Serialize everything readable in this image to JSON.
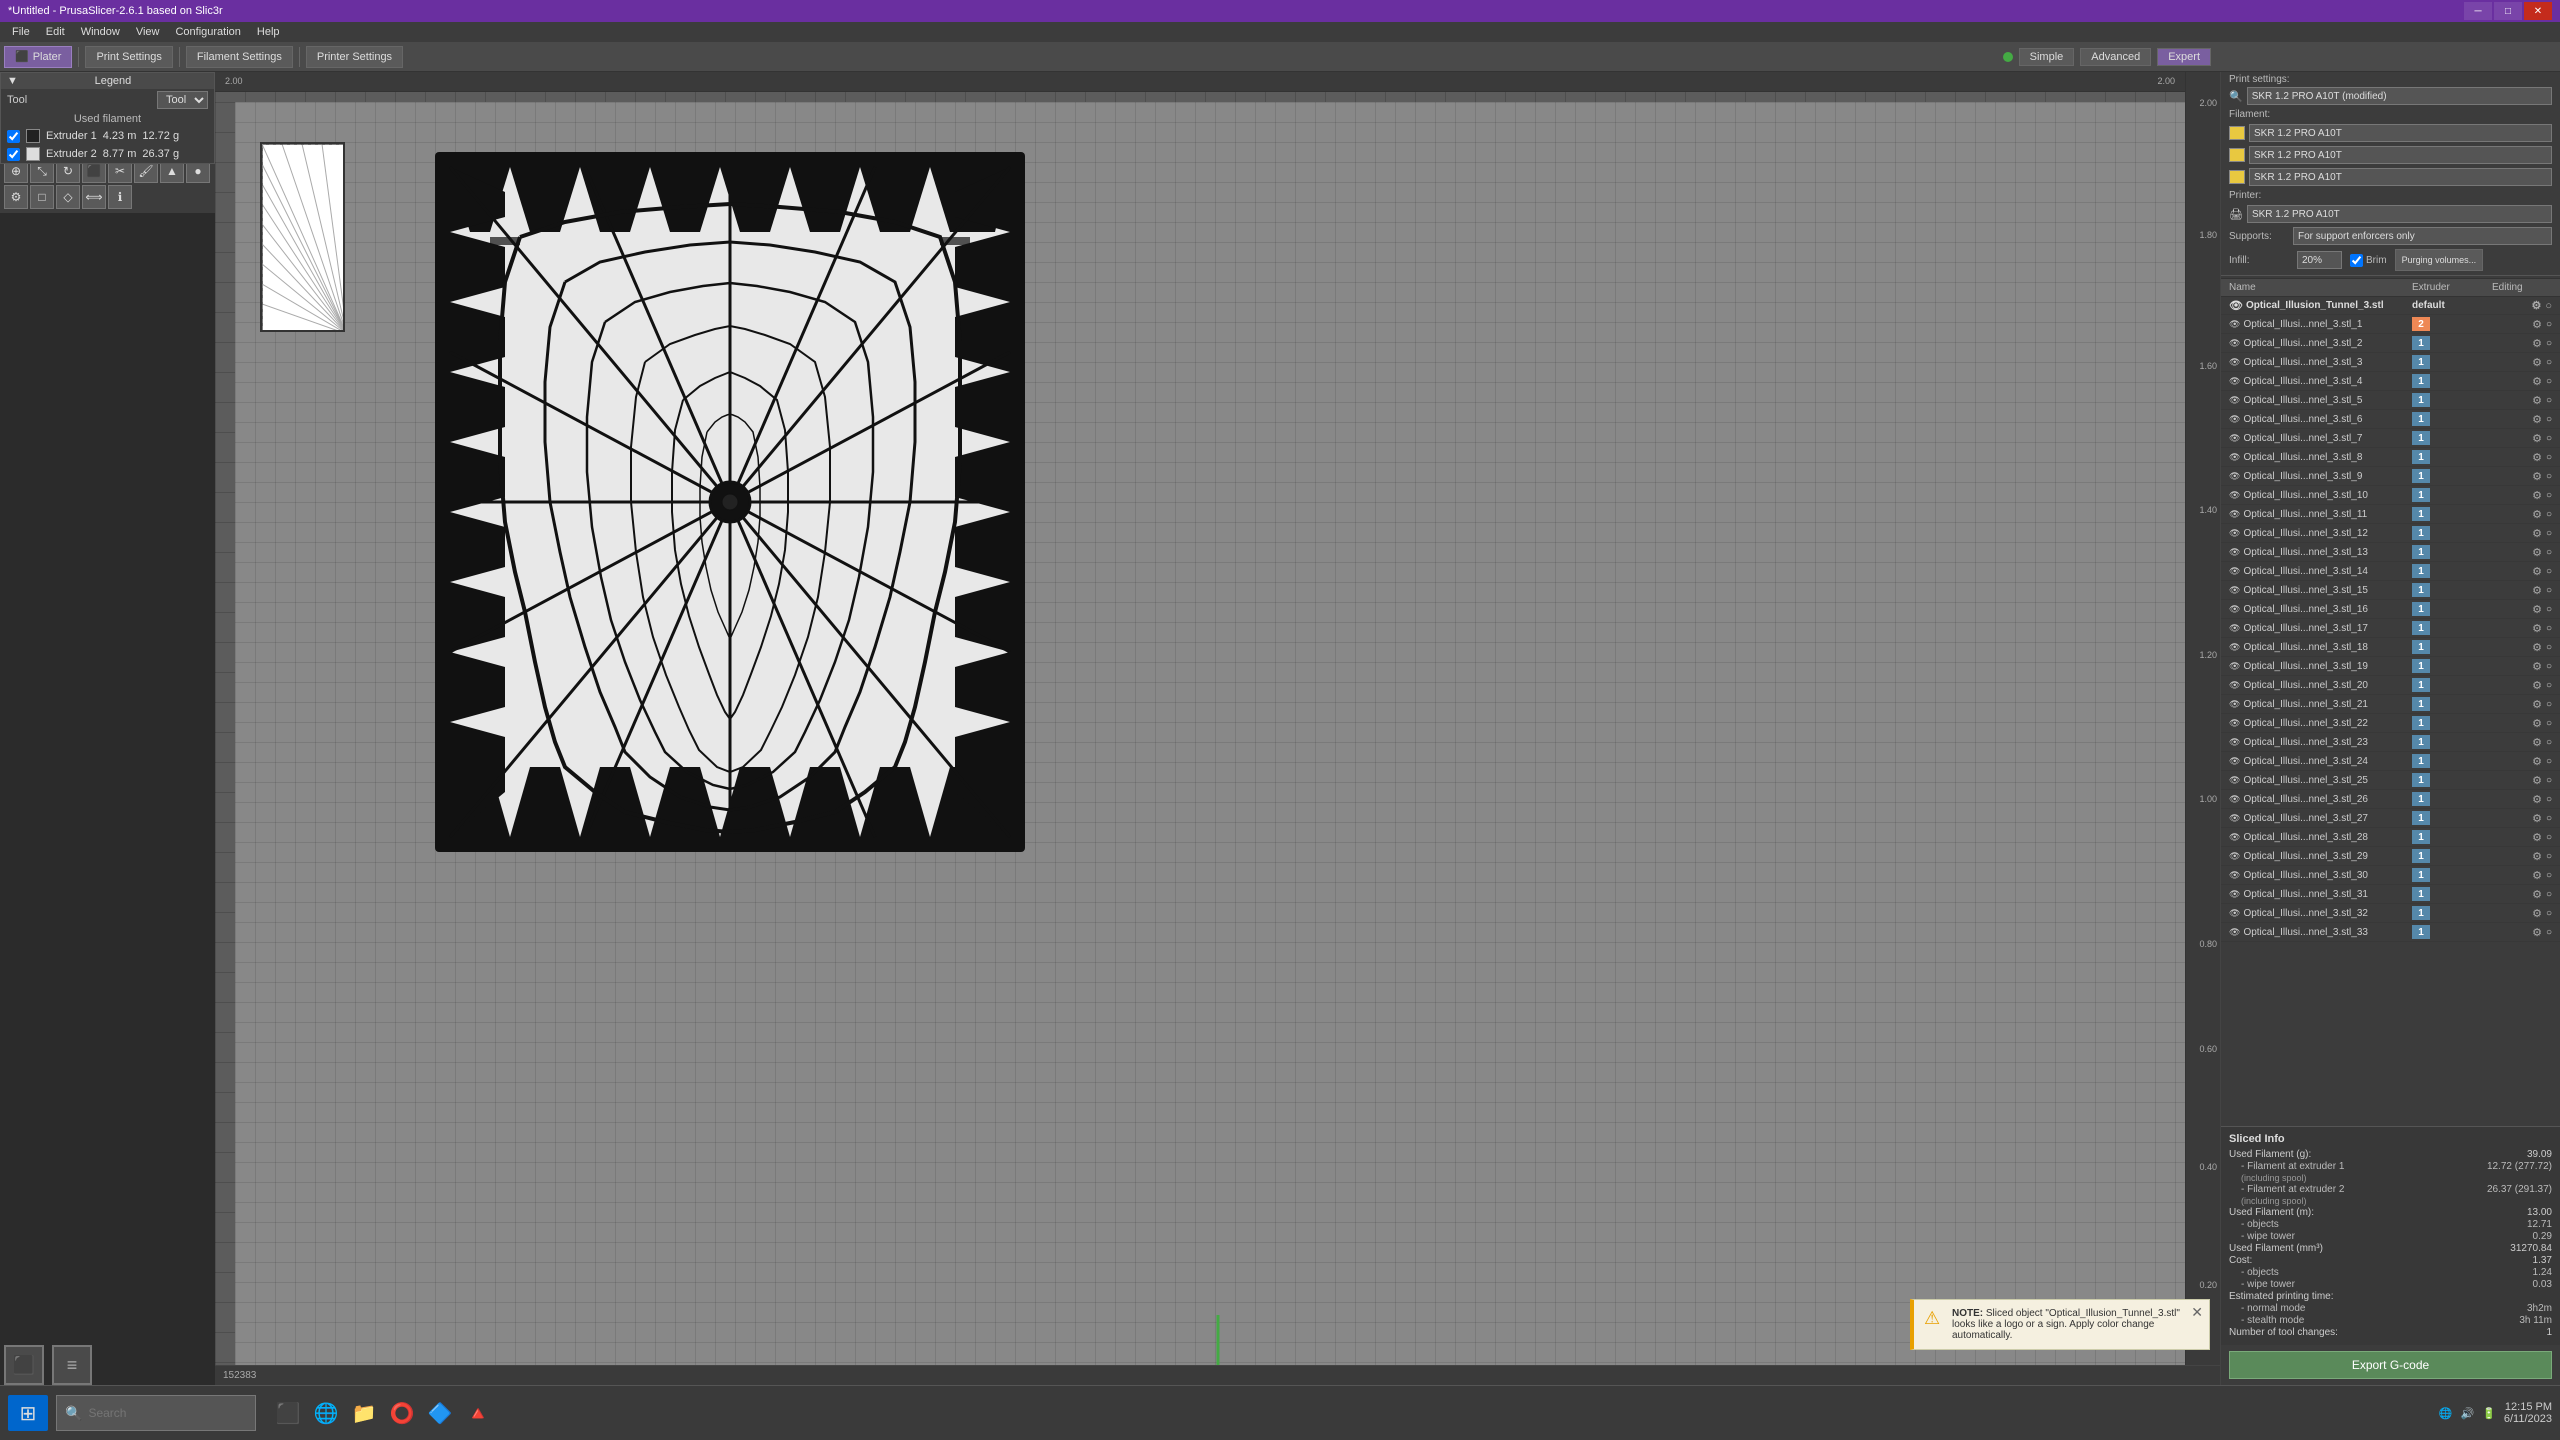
{
  "titlebar": {
    "title": "*Untitled - PrusaSlicer-2.6.1 based on Slic3r",
    "controls": [
      "minimize",
      "maximize",
      "close"
    ]
  },
  "menubar": {
    "items": [
      "File",
      "Edit",
      "Window",
      "View",
      "Configuration",
      "Help"
    ]
  },
  "toolbar": {
    "plater_label": "Plater",
    "print_settings_label": "Print Settings",
    "filament_settings_label": "Filament Settings",
    "printer_settings_label": "Printer Settings"
  },
  "right_mode_buttons": {
    "simple": "Simple",
    "advanced": "Advanced",
    "expert": "Expert"
  },
  "legend": {
    "title": "Legend",
    "tool_label": "Tool",
    "used_filament_label": "Used filament",
    "extruder1_label": "Extruder 1",
    "extruder1_m": "4.23 m",
    "extruder1_g": "12.72 g",
    "extruder2_label": "Extruder 2",
    "extruder2_m": "8.77 m",
    "extruder2_g": "26.37 g"
  },
  "right_panel": {
    "print_settings_title": "Print settings:",
    "print_settings_value": "SKR 1.2 PRO A10T (modified)",
    "filament_title": "Filament:",
    "filaments": [
      {
        "color": "#e8c840",
        "name": "SKR 1.2 PRO A10T"
      },
      {
        "color": "#e8c840",
        "name": "SKR 1.2 PRO A10T"
      },
      {
        "color": "#e8c840",
        "name": "SKR 1.2 PRO A10T"
      }
    ],
    "printer_title": "Printer:",
    "printer_value": "SKR 1.2 PRO A10T",
    "supports_label": "Supports:",
    "supports_value": "For support enforcers only",
    "infill_label": "Infill:",
    "infill_value": "20%",
    "brim_label": "Brim",
    "purging_label": "Purging volumes...",
    "obj_list_headers": [
      "Name",
      "Extruder",
      "Editing"
    ],
    "root_object": "Optical_Illusion_Tunnel_3.stl",
    "objects": [
      "Optical_Illusi...nnel_3.stl_1",
      "Optical_Illusi...nnel_3.stl_2",
      "Optical_Illusi...nnel_3.stl_3",
      "Optical_Illusi...nnel_3.stl_4",
      "Optical_Illusi...nnel_3.stl_5",
      "Optical_Illusi...nnel_3.stl_6",
      "Optical_Illusi...nnel_3.stl_7",
      "Optical_Illusi...nnel_3.stl_8",
      "Optical_Illusi...nnel_3.stl_9",
      "Optical_Illusi...nnel_3.stl_10",
      "Optical_Illusi...nnel_3.stl_11",
      "Optical_Illusi...nnel_3.stl_12",
      "Optical_Illusi...nnel_3.stl_13",
      "Optical_Illusi...nnel_3.stl_14",
      "Optical_Illusi...nnel_3.stl_15",
      "Optical_Illusi...nnel_3.stl_16",
      "Optical_Illusi...nnel_3.stl_17",
      "Optical_Illusi...nnel_3.stl_18",
      "Optical_Illusi...nnel_3.stl_19",
      "Optical_Illusi...nnel_3.stl_20",
      "Optical_Illusi...nnel_3.stl_21",
      "Optical_Illusi...nnel_3.stl_22",
      "Optical_Illusi...nnel_3.stl_23",
      "Optical_Illusi...nnel_3.stl_24",
      "Optical_Illusi...nnel_3.stl_25",
      "Optical_Illusi...nnel_3.stl_26",
      "Optical_Illusi...nnel_3.stl_27",
      "Optical_Illusi...nnel_3.stl_28",
      "Optical_Illusi...nnel_3.stl_29",
      "Optical_Illusi...nnel_3.stl_30",
      "Optical_Illusi...nnel_3.stl_31",
      "Optical_Illusi...nnel_3.stl_32",
      "Optical_Illusi...nnel_3.stl_33"
    ],
    "ext_numbers": [
      2,
      1,
      1,
      1,
      1,
      1,
      1,
      1,
      1,
      1,
      1,
      1,
      1,
      1,
      1,
      1,
      1,
      1,
      1,
      1,
      1,
      1,
      1,
      1,
      1,
      1,
      1,
      1,
      1,
      1,
      1,
      1,
      1
    ]
  },
  "sliced_info": {
    "title": "Sliced Info",
    "used_filament_g_label": "Used Filament (g):",
    "used_filament_g_value": "39.09",
    "filament_ext1_label": "- Filament at extruder 1",
    "filament_ext1_value": "12.72 (277.72)",
    "filament_ext1_note": "(including spool)",
    "filament_ext2_label": "- Filament at extruder 2",
    "filament_ext2_value": "26.37 (291.37)",
    "filament_ext2_note": "(including spool)",
    "used_filament_m_label": "Used Filament (m):",
    "used_filament_m_value": "13.00",
    "objects_m": "- objects",
    "objects_m_val": "12.71",
    "wipe_tower_m": "- wipe tower",
    "wipe_tower_m_val": "0.29",
    "used_filament_mm3_label": "Used Filament (mm³)",
    "used_filament_mm3_value": "31270.84",
    "cost_label": "Cost:",
    "cost_value": "1.37",
    "objects_cost": "- objects",
    "objects_cost_val": "1.24",
    "wipe_tower_cost": "- wipe tower",
    "wipe_tower_cost_val": "0.03",
    "est_time_label": "Estimated printing time:",
    "normal_mode_label": "- normal mode",
    "normal_mode_val": "3h2m",
    "stealth_mode_label": "- stealth mode",
    "stealth_mode_val": "3h 11m",
    "tool_changes_label": "Number of tool changes:",
    "tool_changes_val": "1"
  },
  "export_btn_label": "Export G-code",
  "statusbar": {
    "search_placeholder": "Search",
    "coordinates": "152383",
    "time": "12:15 PM",
    "date": "6/11/2023"
  },
  "notification": {
    "note_label": "NOTE:",
    "message": "Sliced object \"Optical_Illusion_Tunnel_3.stl\" looks like a logo or a sign. Apply color change automatically."
  },
  "rulers": {
    "v_labels": [
      "2.00",
      "1.80",
      "1.60",
      "1.40",
      "1.20",
      "1.00",
      "0.80",
      "0.60",
      "0.40",
      "0.20"
    ],
    "h_label_left": "2.00",
    "h_label_right": "2.00"
  },
  "coord_bar": {
    "coords": "152383"
  }
}
